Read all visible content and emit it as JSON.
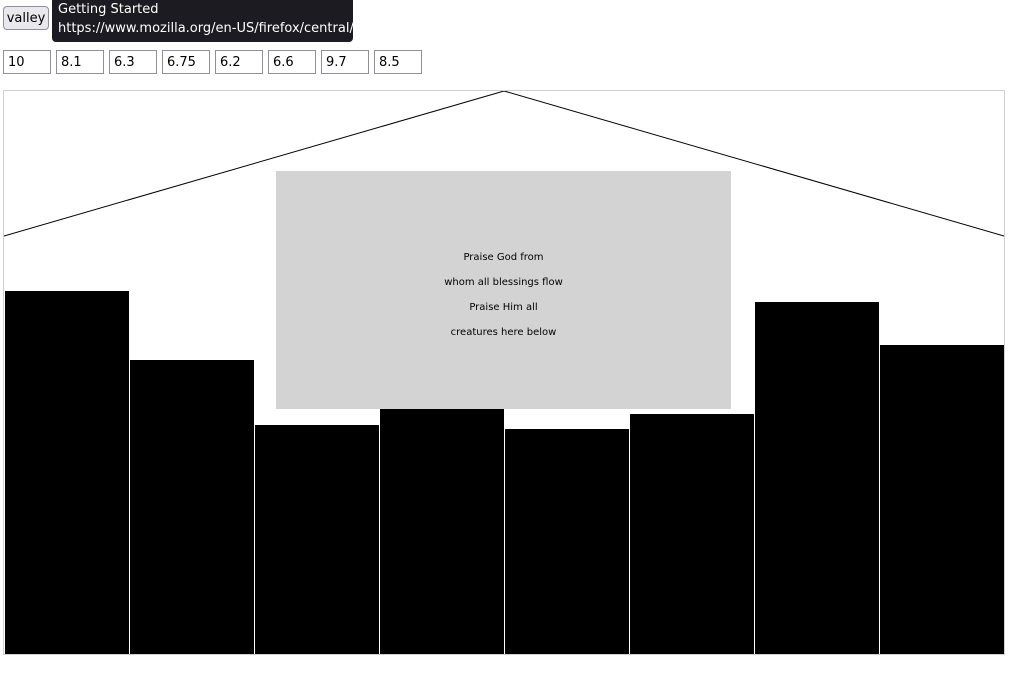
{
  "toolbar": {
    "valley_label": "valley"
  },
  "tooltip": {
    "title": "Getting Started",
    "url": "https://www.mozilla.org/en-US/firefox/central/"
  },
  "inputs": [
    "10",
    "8.1",
    "6.3",
    "6.75",
    "6.2",
    "6.6",
    "9.7",
    "8.5"
  ],
  "chart_data": {
    "type": "bar",
    "values": [
      10,
      8.1,
      6.3,
      6.75,
      6.2,
      6.6,
      9.7,
      8.5
    ],
    "ylim": [
      0,
      10
    ],
    "bar_color": "#000000"
  },
  "lyrics": [
    "Praise God from",
    "whom all blessings flow",
    "Praise Him all",
    "creatures here below"
  ],
  "colors": {
    "panel_bg": "#d3d3d3",
    "bar": "#000000",
    "tooltip_bg": "#1c1b22"
  }
}
